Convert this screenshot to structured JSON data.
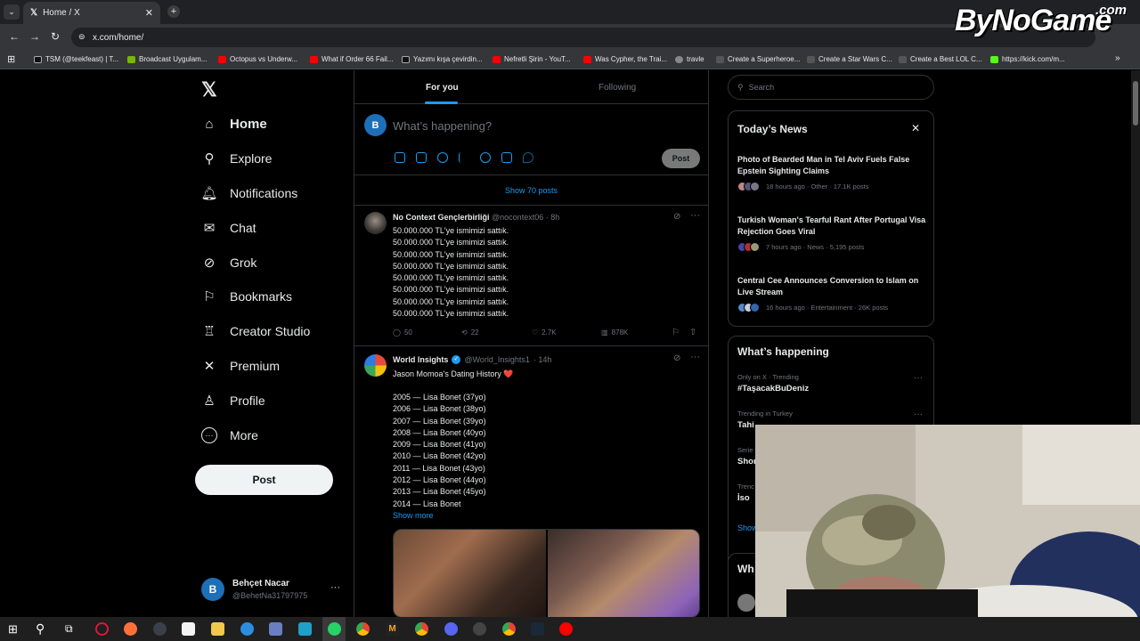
{
  "browser": {
    "tab_title": "Home / X",
    "url": "x.com/home/",
    "bookmarks": [
      {
        "label": "TSM (@teekfeast) | T...",
        "color": "#000000"
      },
      {
        "label": "Broadcast Uygulam...",
        "color": "#76b900"
      },
      {
        "label": "Octopus vs Underw...",
        "color": "#ff0000"
      },
      {
        "label": "What if Order 66 Fail...",
        "color": "#ff0000"
      },
      {
        "label": "Yazımı kışa çevirdin...",
        "color": "#000000"
      },
      {
        "label": "Nefretli Şirin - YouT...",
        "color": "#ff0000"
      },
      {
        "label": "Was Cypher, the Trai...",
        "color": "#ff0000"
      },
      {
        "label": "travle",
        "color": "#888888"
      },
      {
        "label": "Create a Superheroe...",
        "color": "#444444"
      },
      {
        "label": "Create a Star Wars C...",
        "color": "#444444"
      },
      {
        "label": "Create a Best LOL C...",
        "color": "#444444"
      },
      {
        "label": "https://kick.com/m...",
        "color": "#53fc18"
      }
    ],
    "watermark": "ByNoGame",
    "watermark_suffix": ".com"
  },
  "sidebar": {
    "items": [
      {
        "label": "Home",
        "icon": "home-icon",
        "glyph": "⌂"
      },
      {
        "label": "Explore",
        "icon": "search-icon",
        "glyph": "⚲"
      },
      {
        "label": "Notifications",
        "icon": "bell-icon",
        "glyph": "♫"
      },
      {
        "label": "Chat",
        "icon": "mail-icon",
        "glyph": "✉"
      },
      {
        "label": "Grok",
        "icon": "grok-icon",
        "glyph": "⊘"
      },
      {
        "label": "Bookmarks",
        "icon": "bookmark-icon",
        "glyph": "⚑"
      },
      {
        "label": "Creator Studio",
        "icon": "creator-studio-icon",
        "glyph": "♖"
      },
      {
        "label": "Premium",
        "icon": "x-premium-icon",
        "glyph": "✕"
      },
      {
        "label": "Profile",
        "icon": "person-icon",
        "glyph": "♙"
      },
      {
        "label": "More",
        "icon": "more-circle-icon",
        "glyph": "⋯"
      }
    ],
    "post_label": "Post",
    "account": {
      "name": "Behçet Nacar",
      "handle": "@BehetNa31797975",
      "initial": "B"
    }
  },
  "feed": {
    "tab_for_you": "For you",
    "tab_following": "Following",
    "compose_placeholder": "What’s happening?",
    "compose_initial": "B",
    "post_label": "Post",
    "show_posts": "Show 70 posts",
    "tweets": [
      {
        "author": "No Context Gençlerbirliği",
        "handle": "@nocontext06",
        "time": "· 8h",
        "lines": [
          "50.000.000 TL'ye ismimizi sattık.",
          "50.000.000 TL'ye ismimizi sattık.",
          "50.000.000 TL'ye ismimizi sattık.",
          "50.000.000 TL'ye ismimizi sattık.",
          "50.000.000 TL'ye ismimizi sattık.",
          "50.000.000 TL'ye ismimizi sattık.",
          "50.000.000 TL'ye ismimizi sattık.",
          "50.000.000 TL'ye ismimizi sattık."
        ],
        "replies": "50",
        "reposts": "22",
        "likes": "2.7K",
        "views": "878K"
      },
      {
        "author": "World Insights",
        "handle": "@World_Insights1",
        "time": "· 14h",
        "headline": "Jason Momoa’s Dating History ❤️",
        "lines": [
          "2005 — Lisa Bonet (37yo)",
          "2006 — Lisa Bonet (38yo)",
          "2007 — Lisa Bonet (39yo)",
          "2008 — Lisa Bonet (40yo)",
          "2009 — Lisa Bonet (41yo)",
          "2010 — Lisa Bonet (42yo)",
          "2011 — Lisa Bonet (43yo)",
          "2012 — Lisa Bonet (44yo)",
          "2013 — Lisa Bonet (45yo)",
          "2014 — Lisa Bonet"
        ],
        "show_more": "Show more"
      }
    ]
  },
  "right": {
    "search_placeholder": "Search",
    "news_title": "Today’s News",
    "news": [
      {
        "title": "Photo of Bearded Man in Tel Aviv Fuels False Epstein Sighting Claims",
        "meta": "18 hours ago · Other · 17.1K posts"
      },
      {
        "title": "Turkish Woman's Tearful Rant After Portugal Visa Rejection Goes Viral",
        "meta": "7 hours ago · News · 5,195 posts"
      },
      {
        "title": "Central Cee Announces Conversion to Islam on Live Stream",
        "meta": "16 hours ago · Entertainment · 26K posts"
      }
    ],
    "happening_title": "What’s happening",
    "trends": [
      {
        "context": "Only on X · Trending",
        "name": "#TaşacakBuDeniz"
      },
      {
        "context": "Trending in Turkey",
        "name": "Tahi"
      },
      {
        "context": "Serie",
        "name": "Shor"
      },
      {
        "context": "Trenc",
        "name": "İso"
      }
    ],
    "show_more_partial": "Show",
    "next_title_partial": "Wh"
  }
}
